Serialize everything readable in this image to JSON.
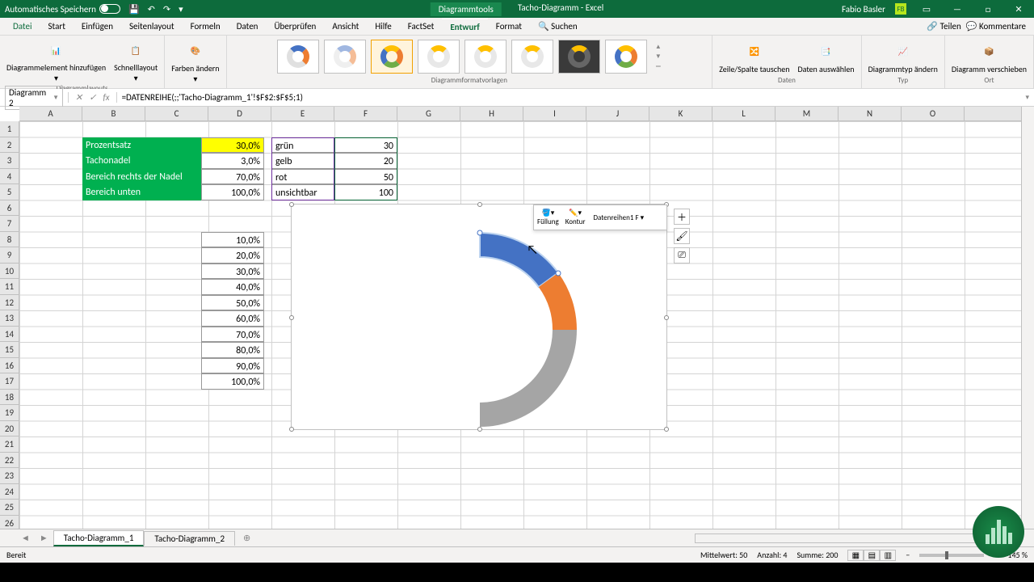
{
  "titlebar": {
    "autosave": "Automatisches Speichern",
    "tool": "Diagrammtools",
    "docname": "Tacho-Diagramm",
    "appname": "Excel",
    "user": "Fabio Basler",
    "userinit": "FB"
  },
  "menu": {
    "datei": "Datei",
    "start": "Start",
    "einfuegen": "Einfügen",
    "seitenlayout": "Seitenlayout",
    "formeln": "Formeln",
    "daten": "Daten",
    "ueberpruefen": "Überprüfen",
    "ansicht": "Ansicht",
    "hilfe": "Hilfe",
    "factset": "FactSet",
    "entwurf": "Entwurf",
    "format": "Format",
    "suchen": "Suchen",
    "teilen": "Teilen",
    "kommentare": "Kommentare"
  },
  "ribbon": {
    "elem": "Diagrammelement hinzufügen",
    "schnell": "Schnelllayout",
    "layouts": "Diagrammlayouts",
    "farben": "Farben ändern",
    "styles": "Diagrammformatvorlagen",
    "zeile": "Zeile/Spalte tauschen",
    "datensel": "Daten auswählen",
    "datengrp": "Daten",
    "typ": "Diagrammtyp ändern",
    "typgrp": "Typ",
    "move": "Diagramm verschieben",
    "ortgrp": "Ort"
  },
  "formula": {
    "name": "Diagramm 2",
    "fx": "fx",
    "formula": "=DATENREIHE(;;'Tacho-Diagramm_1'!$F$2:$F$5;1)"
  },
  "cols": [
    "A",
    "B",
    "C",
    "D",
    "E",
    "F",
    "G",
    "H",
    "I",
    "J",
    "K",
    "L",
    "M",
    "N",
    "O"
  ],
  "rows": [
    "1",
    "2",
    "3",
    "4",
    "5",
    "6",
    "7",
    "8",
    "9",
    "10",
    "11",
    "12",
    "13",
    "14",
    "15",
    "16",
    "17",
    "18",
    "19",
    "20",
    "21",
    "22",
    "23",
    "24",
    "25",
    "26"
  ],
  "tbl1": {
    "r1a": "Prozentsatz",
    "r1b": "30,0%",
    "r2a": "Tachonadel",
    "r2b": "3,0%",
    "r3a": "Bereich rechts der Nadel",
    "r3b": "70,0%",
    "r4a": "Bereich unten",
    "r4b": "100,0%"
  },
  "tbl2": {
    "r1a": "grün",
    "r1b": "30",
    "r2a": "gelb",
    "r2b": "20",
    "r3a": "rot",
    "r3b": "50",
    "r4a": "unsichtbar",
    "r4b": "100"
  },
  "tbl3": [
    "10,0%",
    "20,0%",
    "30,0%",
    "40,0%",
    "50,0%",
    "60,0%",
    "70,0%",
    "80,0%",
    "90,0%",
    "100,0%"
  ],
  "minitb": {
    "fill": "Füllung",
    "outline": "Kontur",
    "series": "Datenreihen1 F"
  },
  "sheets": {
    "s1": "Tacho-Diagramm_1",
    "s2": "Tacho-Diagramm_2"
  },
  "status": {
    "ready": "Bereit",
    "avg": "Mittelwert: 50",
    "cnt": "Anzahl: 4",
    "sum": "Summe: 200",
    "zoom": "145 %"
  },
  "chart_data": {
    "type": "pie",
    "title": "",
    "series": [
      {
        "name": "grün",
        "value": 30,
        "color": "#4472C4"
      },
      {
        "name": "gelb",
        "value": 20,
        "color": "#ED7D31"
      },
      {
        "name": "rot",
        "value": 50,
        "color": "#A5A5A5"
      },
      {
        "name": "unsichtbar",
        "value": 100,
        "color": "transparent"
      }
    ],
    "note": "Half-donut gauge; selected series = grün (30)"
  }
}
